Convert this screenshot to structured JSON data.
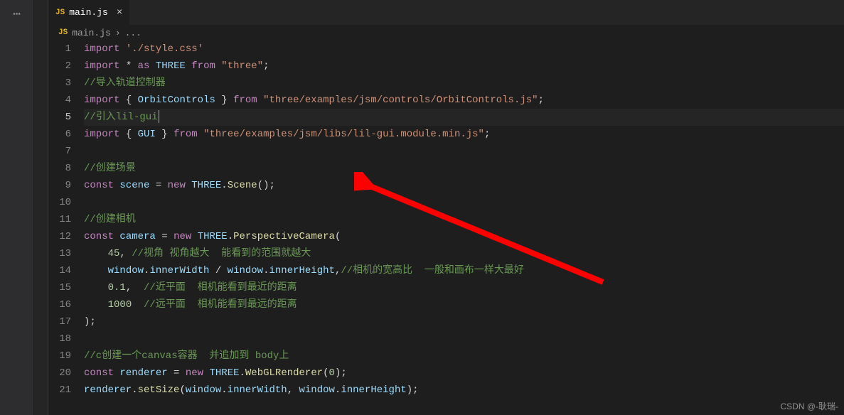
{
  "activity": {
    "more_icon": "⋯"
  },
  "tab": {
    "icon_label": "JS",
    "filename": "main.js",
    "close_glyph": "×"
  },
  "breadcrumbs": {
    "icon_label": "JS",
    "file": "main.js",
    "separator": "›",
    "more": "..."
  },
  "code": {
    "active_line": 5,
    "lines": [
      {
        "num": 1,
        "tokens": [
          [
            "kw",
            "import"
          ],
          [
            "pun",
            " "
          ],
          [
            "str",
            "'./style.css'"
          ]
        ]
      },
      {
        "num": 2,
        "tokens": [
          [
            "kw",
            "import"
          ],
          [
            "pun",
            " "
          ],
          [
            "op",
            "*"
          ],
          [
            "pun",
            " "
          ],
          [
            "kw",
            "as"
          ],
          [
            "pun",
            " "
          ],
          [
            "var",
            "THREE"
          ],
          [
            "pun",
            " "
          ],
          [
            "kw",
            "from"
          ],
          [
            "pun",
            " "
          ],
          [
            "str",
            "\"three\""
          ],
          [
            "pun",
            ";"
          ]
        ]
      },
      {
        "num": 3,
        "tokens": [
          [
            "cmt",
            "//导入轨道控制器"
          ]
        ]
      },
      {
        "num": 4,
        "tokens": [
          [
            "kw",
            "import"
          ],
          [
            "pun",
            " { "
          ],
          [
            "var",
            "OrbitControls"
          ],
          [
            "pun",
            " } "
          ],
          [
            "kw",
            "from"
          ],
          [
            "pun",
            " "
          ],
          [
            "str",
            "\"three/examples/jsm/controls/OrbitControls.js\""
          ],
          [
            "pun",
            ";"
          ]
        ]
      },
      {
        "num": 5,
        "tokens": [
          [
            "cmt",
            "//引入lil-gui"
          ]
        ]
      },
      {
        "num": 6,
        "tokens": [
          [
            "kw",
            "import"
          ],
          [
            "pun",
            " { "
          ],
          [
            "var",
            "GUI"
          ],
          [
            "pun",
            " } "
          ],
          [
            "kw",
            "from"
          ],
          [
            "pun",
            " "
          ],
          [
            "str",
            "\"three/examples/jsm/libs/lil-gui.module.min.js\""
          ],
          [
            "pun",
            ";"
          ]
        ]
      },
      {
        "num": 7,
        "tokens": []
      },
      {
        "num": 8,
        "tokens": [
          [
            "cmt",
            "//创建场景"
          ]
        ]
      },
      {
        "num": 9,
        "tokens": [
          [
            "kw",
            "const"
          ],
          [
            "pun",
            " "
          ],
          [
            "var",
            "scene"
          ],
          [
            "pun",
            " "
          ],
          [
            "op",
            "="
          ],
          [
            "pun",
            " "
          ],
          [
            "kw",
            "new"
          ],
          [
            "pun",
            " "
          ],
          [
            "var",
            "THREE"
          ],
          [
            "pun",
            "."
          ],
          [
            "fn",
            "Scene"
          ],
          [
            "pun",
            "();"
          ]
        ]
      },
      {
        "num": 10,
        "tokens": []
      },
      {
        "num": 11,
        "tokens": [
          [
            "cmt",
            "//创建相机"
          ]
        ]
      },
      {
        "num": 12,
        "tokens": [
          [
            "kw",
            "const"
          ],
          [
            "pun",
            " "
          ],
          [
            "var",
            "camera"
          ],
          [
            "pun",
            " "
          ],
          [
            "op",
            "="
          ],
          [
            "pun",
            " "
          ],
          [
            "kw",
            "new"
          ],
          [
            "pun",
            " "
          ],
          [
            "var",
            "THREE"
          ],
          [
            "pun",
            "."
          ],
          [
            "fn",
            "PerspectiveCamera"
          ],
          [
            "pun",
            "("
          ]
        ]
      },
      {
        "num": 13,
        "tokens": [
          [
            "pun",
            "    "
          ],
          [
            "num",
            "45"
          ],
          [
            "pun",
            ", "
          ],
          [
            "cmt",
            "//视角 视角越大  能看到的范围就越大"
          ]
        ]
      },
      {
        "num": 14,
        "tokens": [
          [
            "pun",
            "    "
          ],
          [
            "var",
            "window"
          ],
          [
            "pun",
            "."
          ],
          [
            "prop",
            "innerWidth"
          ],
          [
            "pun",
            " "
          ],
          [
            "op",
            "/"
          ],
          [
            "pun",
            " "
          ],
          [
            "var",
            "window"
          ],
          [
            "pun",
            "."
          ],
          [
            "prop",
            "innerHeight"
          ],
          [
            "pun",
            ","
          ],
          [
            "cmt",
            "//相机的宽高比  一般和画布一样大最好"
          ]
        ]
      },
      {
        "num": 15,
        "tokens": [
          [
            "pun",
            "    "
          ],
          [
            "num",
            "0.1"
          ],
          [
            "pun",
            ",  "
          ],
          [
            "cmt",
            "//近平面  相机能看到最近的距离"
          ]
        ]
      },
      {
        "num": 16,
        "tokens": [
          [
            "pun",
            "    "
          ],
          [
            "num",
            "1000"
          ],
          [
            "pun",
            "  "
          ],
          [
            "cmt",
            "//远平面  相机能看到最远的距离"
          ]
        ]
      },
      {
        "num": 17,
        "tokens": [
          [
            "pun",
            ");"
          ]
        ]
      },
      {
        "num": 18,
        "tokens": []
      },
      {
        "num": 19,
        "tokens": [
          [
            "cmt",
            "//c创建一个canvas容器  并追加到 body上"
          ]
        ]
      },
      {
        "num": 20,
        "tokens": [
          [
            "kw",
            "const"
          ],
          [
            "pun",
            " "
          ],
          [
            "var",
            "renderer"
          ],
          [
            "pun",
            " "
          ],
          [
            "op",
            "="
          ],
          [
            "pun",
            " "
          ],
          [
            "kw",
            "new"
          ],
          [
            "pun",
            " "
          ],
          [
            "var",
            "THREE"
          ],
          [
            "pun",
            "."
          ],
          [
            "fn",
            "WebGLRenderer"
          ],
          [
            "pun",
            "("
          ],
          [
            "num",
            "0"
          ],
          [
            "pun",
            ");"
          ]
        ]
      },
      {
        "num": 21,
        "tokens": [
          [
            "var",
            "renderer"
          ],
          [
            "pun",
            "."
          ],
          [
            "fn",
            "setSize"
          ],
          [
            "pun",
            "("
          ],
          [
            "var",
            "window"
          ],
          [
            "pun",
            "."
          ],
          [
            "prop",
            "innerWidth"
          ],
          [
            "pun",
            ", "
          ],
          [
            "var",
            "window"
          ],
          [
            "pun",
            "."
          ],
          [
            "prop",
            "innerHeight"
          ],
          [
            "pun",
            ");"
          ]
        ]
      }
    ]
  },
  "annotation": {
    "arrow_color": "#ff0000"
  },
  "watermark": "CSDN @-耿瑞-"
}
